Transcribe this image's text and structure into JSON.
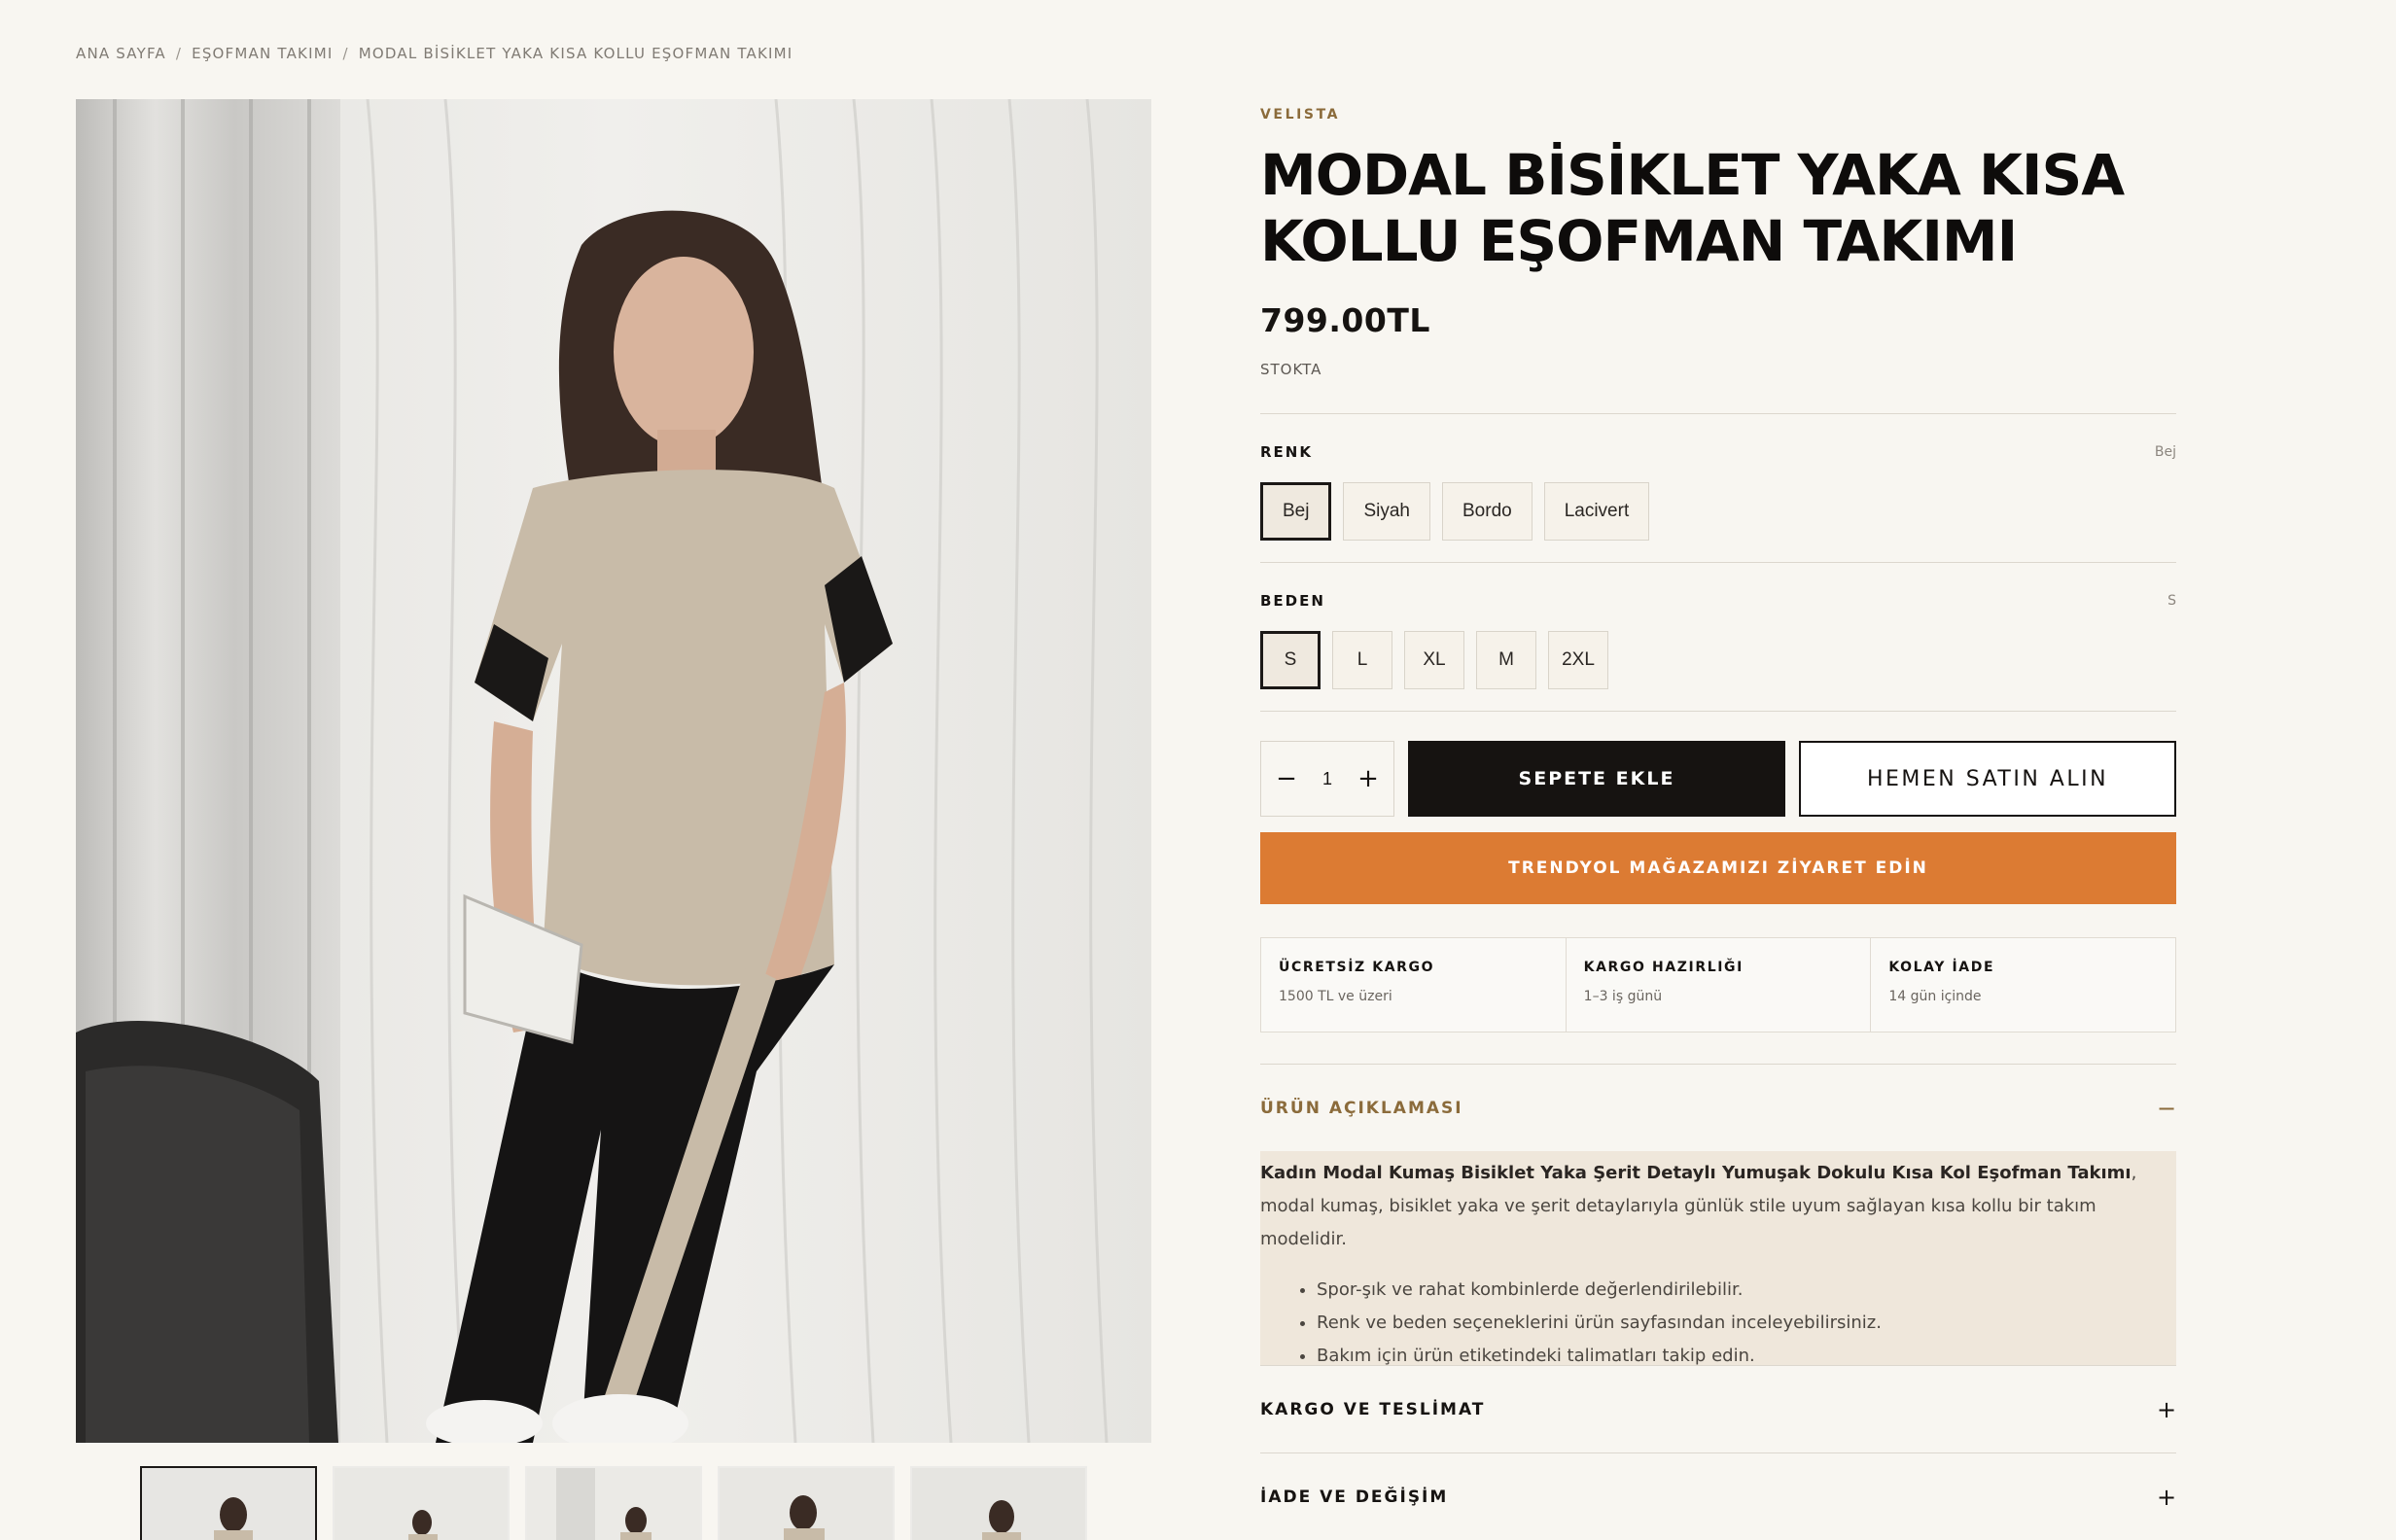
{
  "breadcrumb": {
    "items": [
      "ANA SAYFA",
      "EŞOFMAN TAKIMI",
      "MODAL BİSİKLET YAKA KISA KOLLU EŞOFMAN TAKIMI"
    ],
    "separator": "/"
  },
  "product": {
    "brand": "VELISTA",
    "title": "MODAL BİSİKLET YAKA KISA KOLLU EŞOFMAN TAKIMI",
    "price": "799.00TL",
    "stock": "STOKTA"
  },
  "options": {
    "color": {
      "label": "RENK",
      "selected": "Bej",
      "values": [
        "Bej",
        "Siyah",
        "Bordo",
        "Lacivert"
      ]
    },
    "size": {
      "label": "BEDEN",
      "selected": "S",
      "values": [
        "S",
        "L",
        "XL",
        "M",
        "2XL"
      ]
    }
  },
  "purchase": {
    "quantity": "1",
    "minus": "−",
    "plus": "+",
    "add_to_cart": "SEPETE EKLE",
    "buy_now": "HEMEN SATIN ALIN",
    "store_button": "TRENDYOL MAĞAZAMIZI ZİYARET EDİN"
  },
  "features": [
    {
      "title": "ÜCRETSİZ KARGO",
      "sub": "1500 TL ve üzeri"
    },
    {
      "title": "KARGO HAZIRLIĞI",
      "sub": "1–3 iş günü"
    },
    {
      "title": "KOLAY İADE",
      "sub": "14 gün içinde"
    }
  ],
  "accordion": {
    "description": {
      "title": "ÜRÜN AÇIKLAMASI",
      "icon": "−",
      "lead_bold": "Kadın Modal Kumaş Bisiklet Yaka Şerit Detaylı Yumuşak Dokulu Kısa Kol Eşofman Takımı",
      "lead_rest": ", modal kumaş, bisiklet yaka ve şerit detaylarıyla günlük stile uyum sağlayan kısa kollu bir takım modelidir.",
      "bullets": [
        "Spor-şık ve rahat kombinlerde değerlendirilebilir.",
        "Renk ve beden seçeneklerini ürün sayfasından inceleyebilirsiniz.",
        "Bakım için ürün etiketindeki talimatları takip edin."
      ]
    },
    "shipping": {
      "title": "KARGO VE TESLİMAT",
      "icon": "+"
    },
    "returns": {
      "title": "İADE VE DEĞİŞİM",
      "icon": "+"
    }
  },
  "colors": {
    "accent_gold": "#8b6b3b",
    "store_orange": "#dc7b33",
    "dark": "#161311",
    "background": "#f8f6f1"
  }
}
